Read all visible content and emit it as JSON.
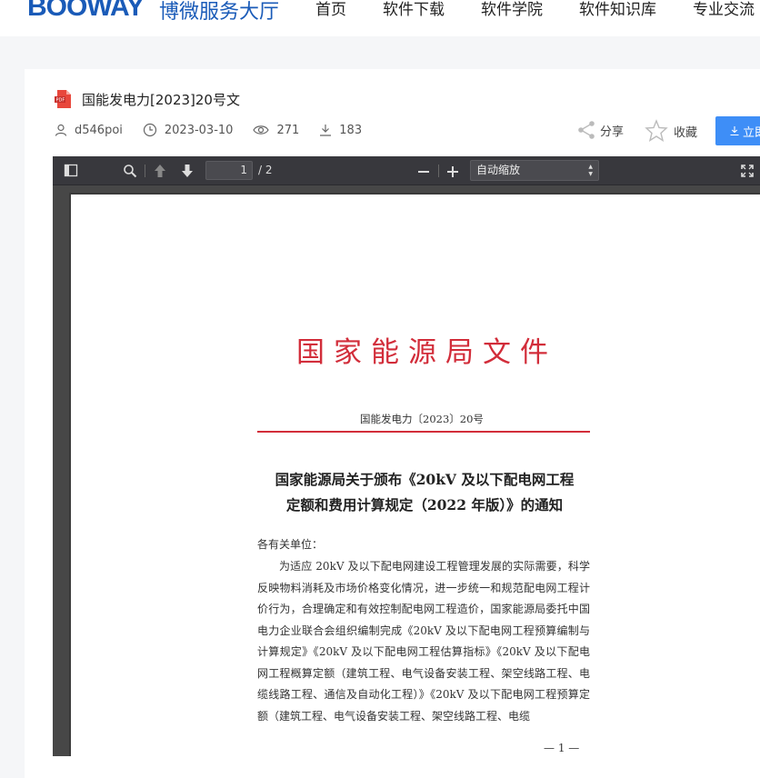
{
  "header": {
    "logo": "BOOWAY",
    "logo_sub": "博微服务大厅",
    "nav": [
      "首页",
      "软件下载",
      "软件学院",
      "软件知识库",
      "专业交流"
    ]
  },
  "doc": {
    "title": "国能发电力[2023]20号文",
    "author": "d546poi",
    "date": "2023-03-10",
    "views": "271",
    "downloads": "183",
    "share_label": "分享",
    "fav_label": "收藏",
    "download_label": "立即下载"
  },
  "viewer": {
    "page_current": "1",
    "page_total": "/ 2",
    "zoom": "自动缩放"
  },
  "page": {
    "org_title": "国家能源局文件",
    "doc_no": "国能发电力〔2023〕20号",
    "notice_title_line1": "国家能源局关于颁布《20kV 及以下配电网工程",
    "notice_title_line2": "定额和费用计算规定（2022 年版）》的通知",
    "salutation": "各有关单位：",
    "body": "为适应 20kV 及以下配电网建设工程管理发展的实际需要，科学反映物料消耗及市场价格变化情况，进一步统一和规范配电网工程计价行为，合理确定和有效控制配电网工程造价，国家能源局委托中国电力企业联合会组织编制完成《20kV 及以下配电网工程预算编制与计算规定》《20kV 及以下配电网工程估算指标》《20kV 及以下配电网工程概算定额（建筑工程、电气设备安装工程、架空线路工程、电缆线路工程、通信及自动化工程）》《20kV 及以下配电网工程预算定额（建筑工程、电气设备安装工程、架空线路工程、电缆",
    "page_num": "— 1 —"
  }
}
